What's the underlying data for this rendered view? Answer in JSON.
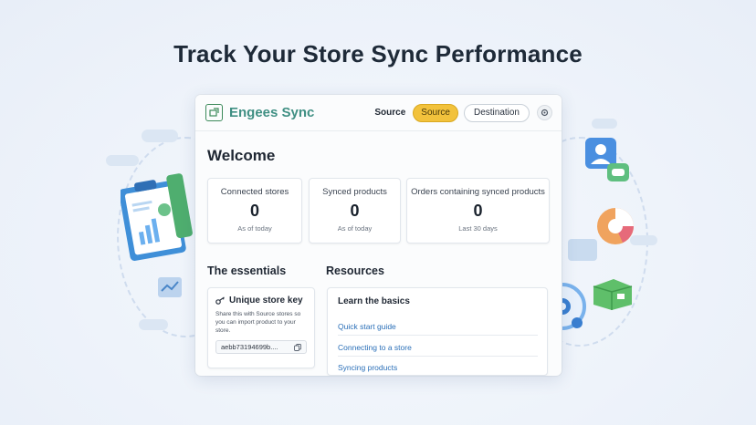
{
  "page": {
    "headline": "Track Your Store Sync Performance"
  },
  "header": {
    "brand": "Engees Sync",
    "source_label": "Source",
    "source_button": "Source",
    "destination_button": "Destination",
    "logo_icon": "store-sync-logo-icon",
    "settings_icon": "settings-icon"
  },
  "main": {
    "welcome": "Welcome"
  },
  "stats": [
    {
      "title": "Connected stores",
      "value": "0",
      "sub": "As of today"
    },
    {
      "title": "Synced products",
      "value": "0",
      "sub": "As of today"
    },
    {
      "title": "Orders containing synced products",
      "value": "0",
      "sub": "Last 30 days"
    }
  ],
  "essentials": {
    "title": "The essentials",
    "card_title": "Unique store key",
    "key_icon": "key-icon",
    "description": "Share this with Source stores so you can import product to your store.",
    "key_value": "aebb73194699b....",
    "copy_icon": "copy-icon"
  },
  "resources": {
    "title": "Resources",
    "card_title": "Learn the basics",
    "links": [
      "Quick start guide",
      "Connecting to a store",
      "Syncing products"
    ]
  },
  "colors": {
    "brand": "#3f8f83",
    "active_pill": "#f2c23c",
    "link": "#2a6fb8"
  }
}
